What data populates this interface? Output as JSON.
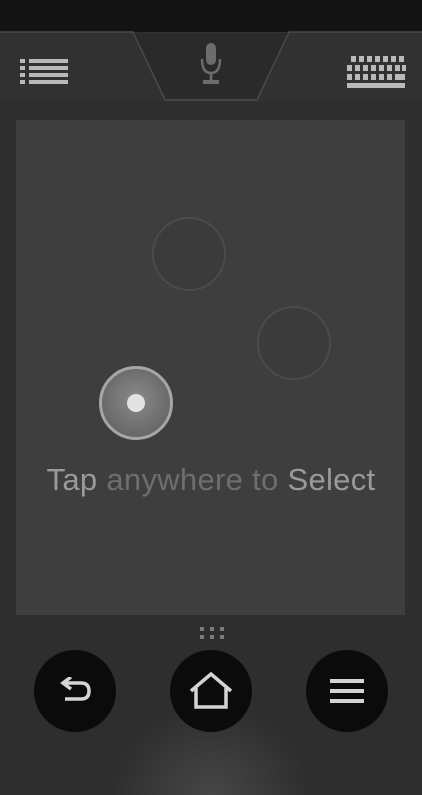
{
  "top_bar": {
    "list_icon": "list-icon",
    "mic_icon": "microphone-icon",
    "keyboard_icon": "keyboard-icon"
  },
  "touchpad": {
    "hint_part1": "Tap",
    "hint_part2": "anywhere to",
    "hint_part3": "Select"
  },
  "bottom_nav": {
    "back_icon": "back-arrow-icon",
    "home_icon": "home-icon",
    "menu_icon": "menu-icon"
  },
  "colors": {
    "background": "#2e2e2e",
    "touchpad": "#3e3e3e",
    "nav_button": "#0b0b0b"
  }
}
